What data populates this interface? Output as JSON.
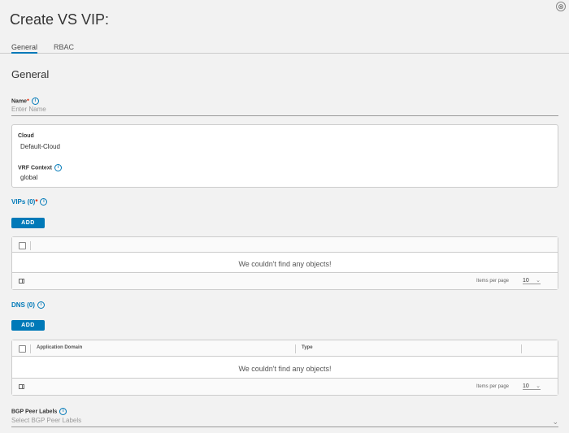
{
  "dialog": {
    "title": "Create VS VIP:",
    "close_glyph": "⊗"
  },
  "tabs": [
    {
      "label": "General",
      "active": true
    },
    {
      "label": "RBAC",
      "active": false
    }
  ],
  "general": {
    "section_title": "General",
    "name": {
      "label": "Name",
      "required_mark": "*",
      "placeholder": "Enter Name",
      "value": ""
    },
    "cloud": {
      "label": "Cloud",
      "value": "Default-Cloud"
    },
    "vrf": {
      "label": "VRF Context",
      "value": "global"
    }
  },
  "vips": {
    "label": "VIPs (0)",
    "required_mark": "*",
    "add_label": "ADD",
    "empty_message": "We couldn't find any objects!",
    "items_per_page_label": "Items per page",
    "page_size": "10"
  },
  "dns": {
    "label": "DNS (0)",
    "add_label": "ADD",
    "columns": [
      "Application Domain",
      "Type"
    ],
    "empty_message": "We couldn't find any objects!",
    "items_per_page_label": "Items per page",
    "page_size": "10"
  },
  "bgp": {
    "label": "BGP Peer Labels",
    "placeholder": "Select BGP Peer Labels"
  },
  "info_glyph": "i",
  "chevron_glyph": "⌄",
  "colors": {
    "accent": "#0079b8",
    "required": "#e12200",
    "background": "#f2f2f2"
  }
}
